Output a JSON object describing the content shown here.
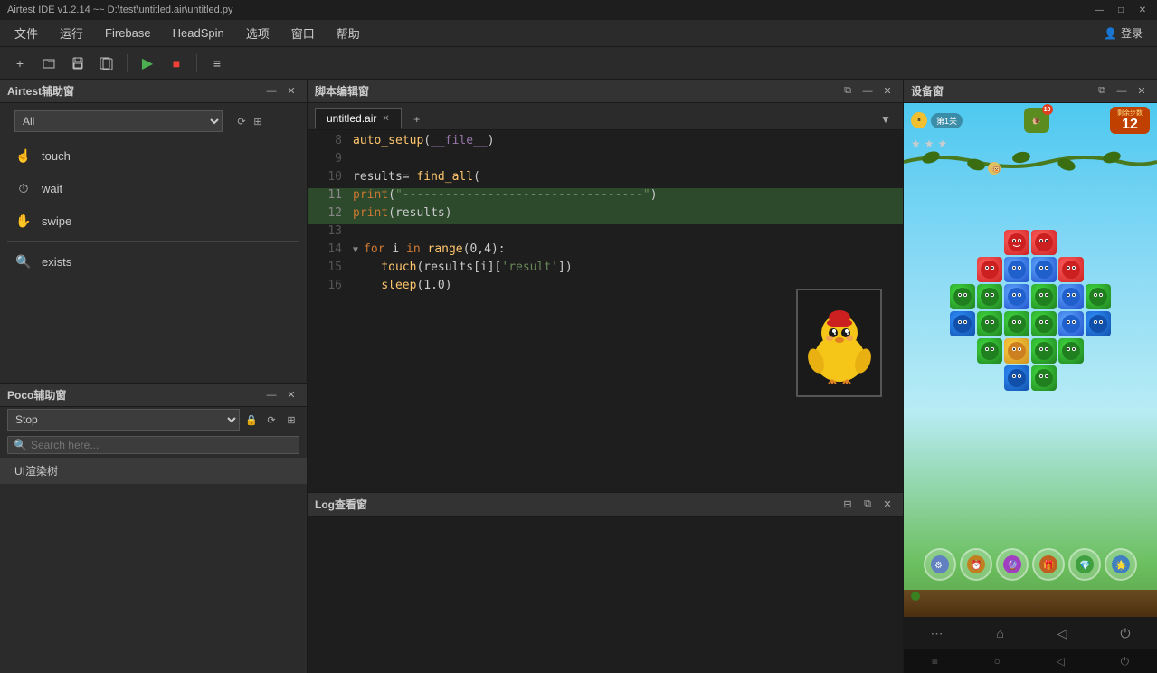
{
  "titlebar": {
    "title": "Airtest IDE v1.2.14 ~~ D:\\test\\untitled.air\\untitled.py",
    "min_label": "—",
    "max_label": "□",
    "close_label": "✕"
  },
  "menubar": {
    "items": [
      "文件",
      "运行",
      "Firebase",
      "HeadSpin",
      "选项",
      "窗口",
      "帮助"
    ],
    "login_label": "登录"
  },
  "toolbar": {
    "buttons": [
      {
        "name": "new-btn",
        "icon": "+"
      },
      {
        "name": "open-btn",
        "icon": "📂"
      },
      {
        "name": "save-btn",
        "icon": "💾"
      },
      {
        "name": "save-all-btn",
        "icon": "💾"
      },
      {
        "name": "run-btn",
        "icon": "▶"
      },
      {
        "name": "stop-btn",
        "icon": "■"
      },
      {
        "name": "record-btn",
        "icon": "≡"
      }
    ]
  },
  "airtest_panel": {
    "title": "Airtest辅助窗",
    "dropdown_value": "All",
    "helpers": [
      {
        "name": "touch",
        "icon": "👆"
      },
      {
        "name": "wait",
        "icon": "🔍"
      },
      {
        "name": "swipe",
        "icon": "👋"
      },
      {
        "name": "exists",
        "icon": "🔍"
      }
    ]
  },
  "poco_panel": {
    "title": "Poco辅助窗",
    "dropdown_value": "Stop",
    "search_placeholder": "Search here...",
    "tree_label": "UI渲染树"
  },
  "script_editor": {
    "title": "脚本编辑窗",
    "tab_name": "untitled.air",
    "lines": [
      {
        "num": 8,
        "content": "auto_setup(__file__)",
        "type": "normal"
      },
      {
        "num": 9,
        "content": "",
        "type": "normal"
      },
      {
        "num": 10,
        "content": "results= find_all(",
        "type": "normal"
      },
      {
        "num": 11,
        "content": "print(\"----------------------------------\")",
        "type": "highlight"
      },
      {
        "num": 12,
        "content": "print(results)",
        "type": "highlight"
      },
      {
        "num": 13,
        "content": "",
        "type": "normal"
      },
      {
        "num": 14,
        "content": "for i in range(0,4):",
        "type": "normal",
        "has_arrow": true
      },
      {
        "num": 15,
        "content": "    touch(results[i]['result'])",
        "type": "normal"
      },
      {
        "num": 16,
        "content": "    sleep(1.0)",
        "type": "normal"
      }
    ]
  },
  "log_panel": {
    "title": "Log查看窗"
  },
  "device_panel": {
    "title": "设备窗",
    "game": {
      "level": "第1关",
      "score_label": "剩余步数",
      "score_value": "12",
      "moves_left": "10"
    },
    "nav_icons": [
      "◀",
      "⊙",
      "■",
      "⋯",
      "⌂",
      "◁",
      "⏻"
    ]
  }
}
